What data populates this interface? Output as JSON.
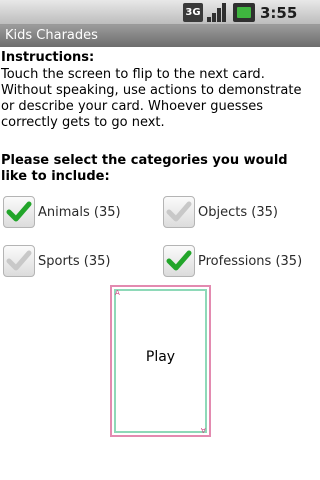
{
  "status_bar": {
    "network_label": "3G",
    "time": "3:55 PM",
    "icons": [
      "3g-icon",
      "signal-icon",
      "battery-icon"
    ]
  },
  "app": {
    "title": "Kids Charades"
  },
  "instructions": {
    "heading": "Instructions:",
    "body": "Touch the screen to flip to the next card. Without speaking, use actions to demonstrate or describe your card. Whoever guesses correctly gets to go next."
  },
  "categories": {
    "heading": "Please select the categories you would like to include:",
    "items": [
      {
        "label": "Animals (35)",
        "checked": true
      },
      {
        "label": "Objects (35)",
        "checked": false
      },
      {
        "label": "Sports (35)",
        "checked": false
      },
      {
        "label": "Professions (35)",
        "checked": true
      }
    ]
  },
  "card": {
    "label": "Play",
    "corner_top": "A",
    "corner_bottom": "A"
  },
  "colors": {
    "check_on": "#22a52a",
    "check_off": "#c8c8c8",
    "card_border_outer": "#e38ab0",
    "card_border_inner": "#8ed9b8"
  }
}
